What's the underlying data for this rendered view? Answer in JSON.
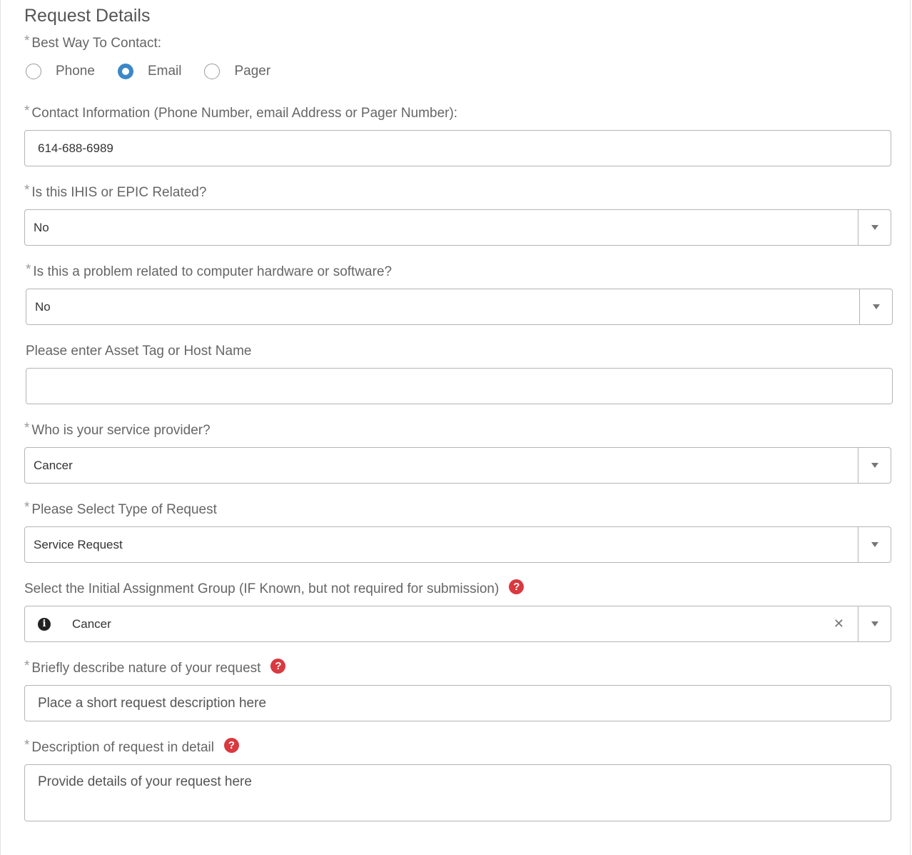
{
  "section_title": "Request Details",
  "required_marker": "*",
  "contact_method": {
    "label": "Best Way To Contact:",
    "options": [
      "Phone",
      "Email",
      "Pager"
    ],
    "selected": "Email"
  },
  "contact_info": {
    "label": "Contact Information (Phone Number, email Address or Pager Number):",
    "value": "614-688-6989"
  },
  "ihis_epic": {
    "label": "Is this IHIS or EPIC Related?",
    "value": "No"
  },
  "hw_sw": {
    "label": "Is this a problem related to computer hardware or software?",
    "value": "No"
  },
  "asset_tag": {
    "label": "Please enter Asset Tag or Host Name",
    "value": ""
  },
  "service_provider": {
    "label": "Who is your service provider?",
    "value": "Cancer"
  },
  "request_type": {
    "label": "Please Select Type of Request",
    "value": "Service Request"
  },
  "assignment_group": {
    "label": "Select the Initial Assignment Group (IF Known, but not required for submission)",
    "value": "Cancer",
    "info_glyph": "i",
    "clear_glyph": "✕"
  },
  "short_desc": {
    "label": "Briefly describe nature of your request",
    "placeholder": "Place a short request description here"
  },
  "detail_desc": {
    "label": "Description of request in detail",
    "placeholder": "Provide details of your request here"
  },
  "help_glyph": "?",
  "colors": {
    "radio_checked": "#3c87c8",
    "help_icon": "#d9393f"
  }
}
